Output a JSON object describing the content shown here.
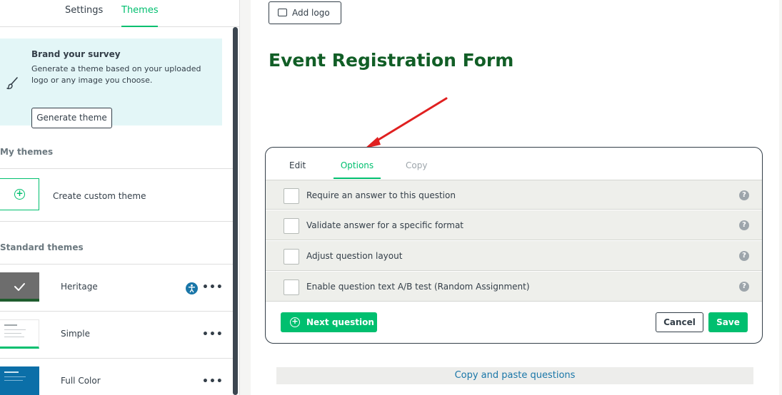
{
  "left_panel": {
    "tabs": [
      {
        "label": "Settings",
        "active": false
      },
      {
        "label": "Themes",
        "active": true
      }
    ],
    "brand": {
      "title": "Brand your survey",
      "description": "Generate a theme based on your uploaded logo or any image you choose.",
      "button": "Generate theme"
    },
    "my_themes_label": "My themes",
    "create_custom_label": "Create custom theme",
    "standard_themes_label": "Standard themes",
    "themes": [
      {
        "name": "Heritage",
        "selected": true,
        "accessible": true
      },
      {
        "name": "Simple",
        "selected": false,
        "accessible": false
      },
      {
        "name": "Full Color",
        "selected": false,
        "accessible": false
      }
    ],
    "more_icon": "•••"
  },
  "canvas": {
    "add_logo": "Add logo",
    "survey_title": "Event Registration Form",
    "question_card": {
      "tabs": [
        "Edit",
        "Options",
        "Copy"
      ],
      "active_tab": "Options",
      "options": [
        {
          "label": "Require an answer to this question",
          "checked": false
        },
        {
          "label": "Validate answer for a specific format",
          "checked": false
        },
        {
          "label": "Adjust question layout",
          "checked": false
        },
        {
          "label": "Enable question text A/B test (Random Assignment)",
          "checked": false
        }
      ],
      "help_icon": "?",
      "next_question": "Next question",
      "cancel": "Cancel",
      "save": "Save"
    },
    "copy_paste": "Copy and paste questions"
  },
  "colors": {
    "accent": "#00bf6f",
    "title_green": "#115e26",
    "annotation_arrow": "#e02020",
    "brand_bg": "#e3f6f7",
    "link_blue": "#1976a8"
  }
}
